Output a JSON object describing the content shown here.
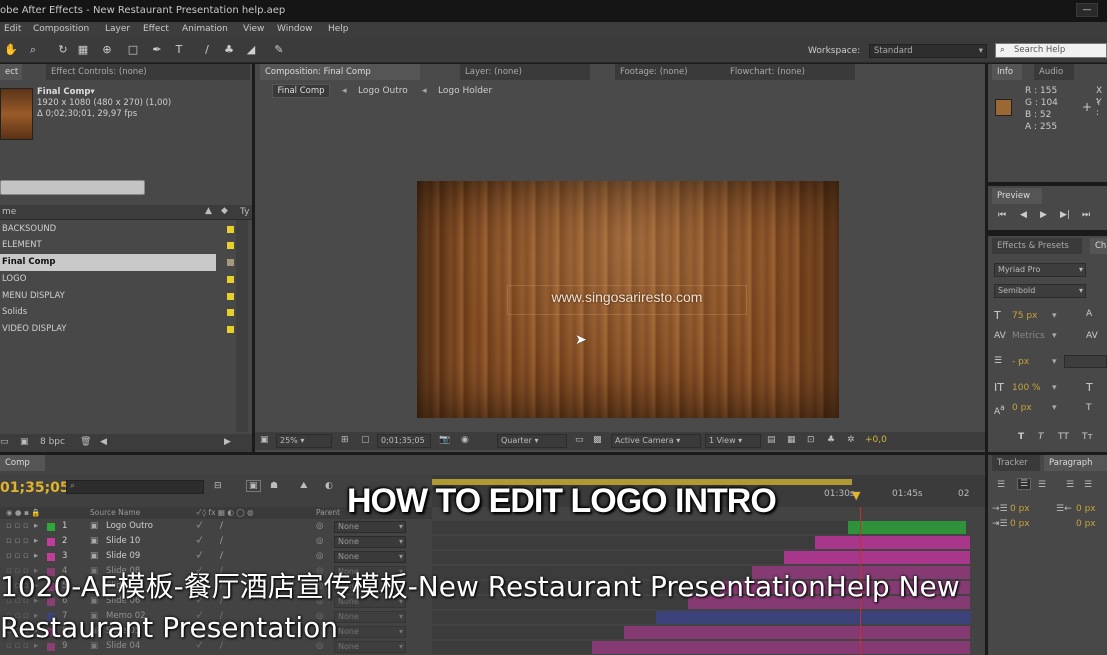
{
  "window": {
    "title": "obe After Effects - New Restaurant Presentation help.aep",
    "minimize": "—",
    "maximize": "□"
  },
  "menu": [
    "Edit",
    "Composition",
    "Layer",
    "Effect",
    "Animation",
    "View",
    "Window",
    "Help"
  ],
  "toolbar": {
    "workspace_label": "Workspace:",
    "workspace_value": "Standard",
    "search_placeholder": "Search Help"
  },
  "project_panel": {
    "tab_project": "ect",
    "tab_effect_controls": "Effect Controls: (none)",
    "comp_name": "Final Comp▾",
    "comp_size": "1920 x 1080  (480 x 270) (1,00)",
    "comp_duration": "Δ 0;02;30;01, 29,97 fps",
    "col_name": "me",
    "col_type": "Ty",
    "items": [
      "BACKSOUND",
      "ELEMENT",
      "Final Comp",
      "LOGO",
      "MENU DISPLAY",
      "Solids",
      "VIDEO DISPLAY"
    ],
    "bpc": "8 bpc"
  },
  "comp_panel": {
    "tab_comp": "Composition: Final Comp",
    "tab_layer": "Layer: (none)",
    "tab_footage": "Footage: (none)",
    "tab_flowchart": "Flowchart: (none)",
    "breadcrumbs": [
      "Final Comp",
      "Logo Outro",
      "Logo Holder"
    ],
    "viewer_text": "www.singosariresto.com",
    "zoom": "25%",
    "timecode": "0;01;35;05",
    "resolution": "Quarter",
    "camera": "Active Camera",
    "views": "1 View",
    "exposure": "+0,0"
  },
  "info_panel": {
    "tab_info": "Info",
    "tab_audio": "Audio",
    "r": "R : 155",
    "g": "G : 104",
    "b": "B : 52",
    "a": "A : 255",
    "x": "X :",
    "y": "Y :",
    "swatch_color": "#9b6834"
  },
  "preview_panel": {
    "tab": "Preview"
  },
  "effects_panel": {
    "tab": "Effects & Presets",
    "tab2": "Ch"
  },
  "character_panel": {
    "font": "Myriad Pro",
    "style": "Semibold",
    "size": "75 px",
    "kerning": "Metrics",
    "leading": "- px",
    "vscale": "100 %",
    "baseline": "0 px"
  },
  "paragraph_panel": {
    "tab_tracker": "Tracker",
    "tab_paragraph": "Paragraph",
    "indent1": "0 px",
    "indent2": "0 px",
    "indent3": "0 px",
    "indent4": "0 px",
    "indent5": "0 px"
  },
  "timeline": {
    "tab": "Comp",
    "timecode": "01;35;05",
    "col_source": "Source Name",
    "col_parent": "Parent",
    "ruler": [
      "01:30s",
      "01:45s",
      "02"
    ],
    "layers": [
      {
        "num": "1",
        "name": "Logo Outro",
        "parent": "None",
        "color": "#2fa83a"
      },
      {
        "num": "2",
        "name": "Slide 10",
        "parent": "None",
        "color": "#c23c9a"
      },
      {
        "num": "3",
        "name": "Slide 09",
        "parent": "None",
        "color": "#c23c9a"
      },
      {
        "num": "4",
        "name": "Slide 08",
        "parent": "None",
        "color": "#c23c9a"
      },
      {
        "num": "5",
        "name": "Slide 07",
        "parent": "None",
        "color": "#c23c9a"
      },
      {
        "num": "6",
        "name": "Slide 06",
        "parent": "None",
        "color": "#c23c9a"
      },
      {
        "num": "7",
        "name": "Memo 02",
        "parent": "None",
        "color": "#3848a8"
      },
      {
        "num": "8",
        "name": "Slide 05",
        "parent": "None",
        "color": "#c23c9a"
      },
      {
        "num": "9",
        "name": "Slide 04",
        "parent": "None",
        "color": "#c23c9a"
      }
    ]
  },
  "overlay": {
    "heading": "HOW TO EDIT LOGO INTRO",
    "caption_line1": "1020-AE模板-餐厅酒店宣传模板-New Restaurant PresentationHelp New",
    "caption_line2": "Restaurant Presentation"
  }
}
